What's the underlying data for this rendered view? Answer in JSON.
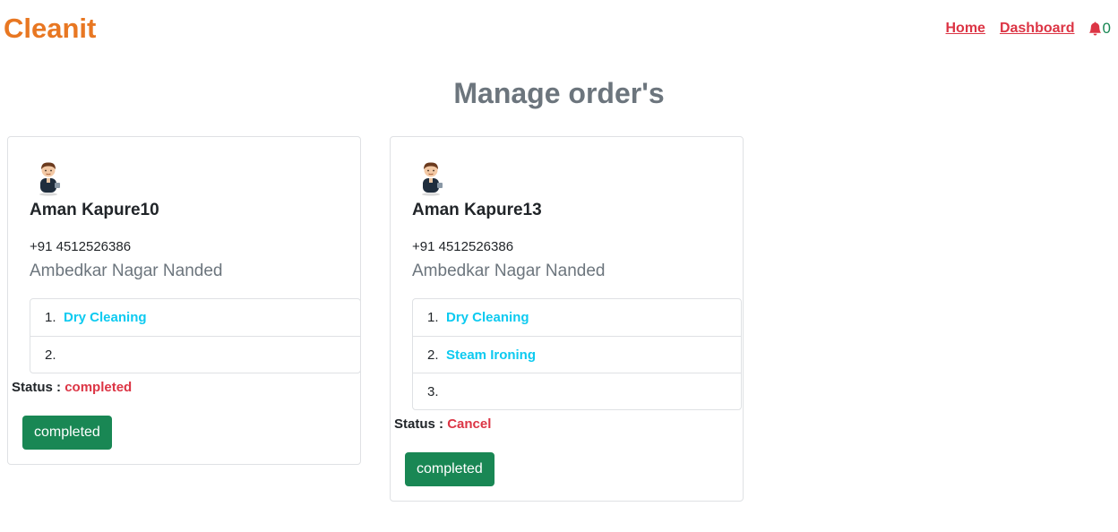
{
  "brand": "Cleanit",
  "nav": {
    "home": "Home",
    "dashboard": "Dashboard",
    "notification_count": "0"
  },
  "page_title": "Manage order's",
  "orders": [
    {
      "name": "Aman Kapure10",
      "phone": "+91 4512526386",
      "address": "Ambedkar Nagar Nanded",
      "items": [
        {
          "num": "1.",
          "service": "Dry Cleaning"
        },
        {
          "num": "2.",
          "service": ""
        }
      ],
      "status_label": "Status :",
      "status_value": "completed",
      "button_label": "completed"
    },
    {
      "name": "Aman Kapure13",
      "phone": "+91 4512526386",
      "address": "Ambedkar Nagar Nanded",
      "items": [
        {
          "num": "1.",
          "service": "Dry Cleaning"
        },
        {
          "num": "2.",
          "service": "Steam Ironing"
        },
        {
          "num": "3.",
          "service": ""
        }
      ],
      "status_label": "Status :",
      "status_value": "Cancel",
      "button_label": "completed"
    }
  ],
  "colors": {
    "brand": "#e87722",
    "link": "#dc3545",
    "service": "#0dcaf0",
    "button": "#198754",
    "title": "#6c757d"
  },
  "icons": {
    "notification": "bell-icon",
    "avatar": "user-avatar-icon"
  }
}
